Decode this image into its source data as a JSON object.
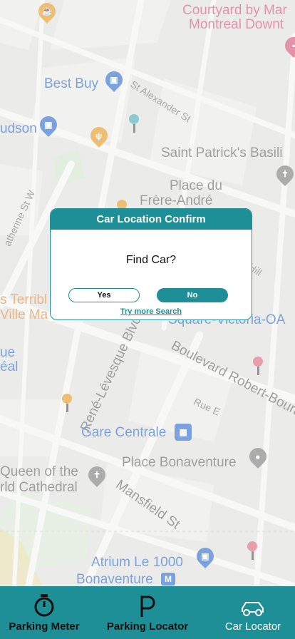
{
  "map": {
    "labels": {
      "courtyard": "Courtyard by Mar",
      "montreal_downtown": "Montreal Downt",
      "best_buy": "Best Buy",
      "st_alexander": "St Alexander St",
      "udson": "udson",
      "saint_patricks": "Saint Patrick's Basili",
      "place_du": "Place du",
      "frere_andre": "Frère-André",
      "catherine_st": "atherine St W",
      "hill": "Hill",
      "s_terribl": "s Terribl",
      "ville_ma": "Ville Ma",
      "square_victoria": "Square-Victoria-OA",
      "rene_levesque": "René-Lévesque Blvd W",
      "boulevard_robert": "Boulevard Robert-Bouras",
      "rue_e": "Rue E",
      "ue": "ue",
      "eal": "éal",
      "gare_centrale": "Gare Centrale",
      "place_bonaventure": "Place Bonaventure",
      "queen_of_the": "Queen of the",
      "rld_cathedral": "rld Cathedral",
      "mansfield": "Mansfield St",
      "atrium": "Atrium Le 1000",
      "bonaventure": "Bonaventure"
    }
  },
  "dialog": {
    "title": "Car Location Confirm",
    "question": "Find Car?",
    "yes_label": "Yes",
    "no_label": "No",
    "more_search_label": "Try more Search"
  },
  "tabs": [
    {
      "label": "Parking Meter",
      "icon": "stopwatch-icon"
    },
    {
      "label": "Parking Locator",
      "icon": "parking-p-icon"
    },
    {
      "label": "Car Locator",
      "icon": "car-icon"
    }
  ],
  "colors": {
    "accent": "#1f8f97",
    "map_blue": "#4a7fd0",
    "map_pink": "#d86a86"
  }
}
